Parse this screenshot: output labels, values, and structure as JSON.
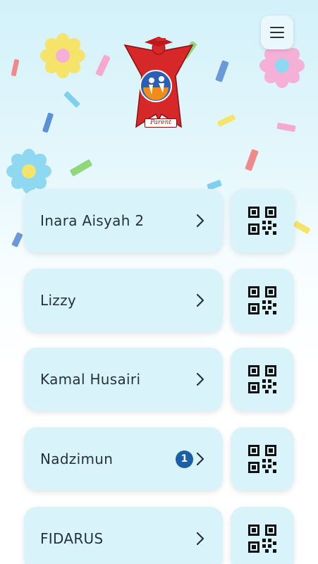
{
  "header": {
    "menu_icon": "hamburger-menu-icon",
    "logo_tag": "Parent"
  },
  "children": [
    {
      "name": "Inara Aisyah 2",
      "badge": ""
    },
    {
      "name": "Lizzy",
      "badge": ""
    },
    {
      "name": "Kamal Husairi",
      "badge": ""
    },
    {
      "name": "Nadzimun",
      "badge": "1"
    },
    {
      "name": "FIDARUS",
      "badge": ""
    }
  ],
  "row_icons": {
    "chevron": "chevron-right-icon",
    "qr": "qr-code-icon"
  },
  "colors": {
    "card_bg": "#d9f3fb",
    "text": "#26323a",
    "badge_bg": "#1b5fa8",
    "logo_red": "#d62828"
  }
}
